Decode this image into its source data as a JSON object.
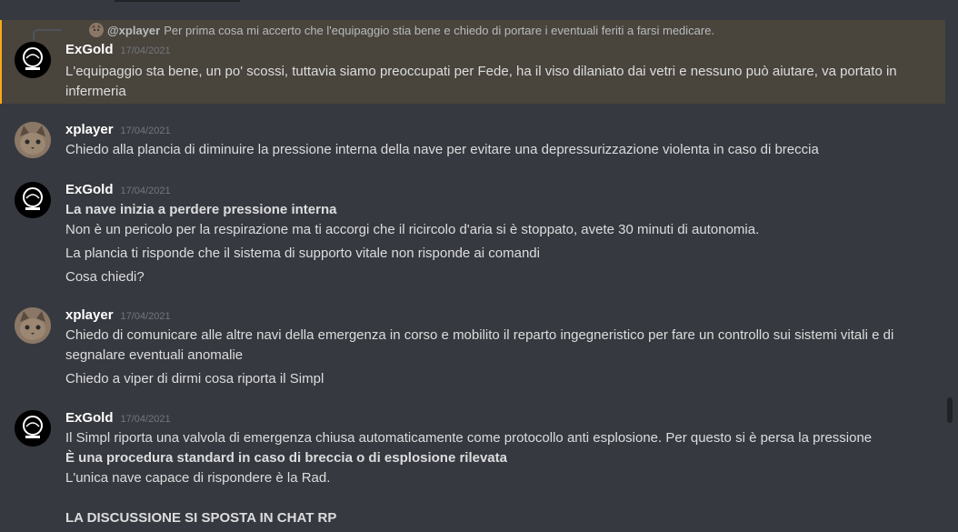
{
  "messages": [
    {
      "reply": {
        "author": "@xplayer",
        "text": "Per prima cosa mi accerto che l'equipaggio stia bene e chiedo di portare i eventuali feriti a farsi medicare."
      },
      "author": "ExGold",
      "timestamp": "17/04/2021",
      "lines": [
        "L'equipaggio sta bene, un po' scossi, tuttavia siamo preoccupati per Fede, ha il viso dilaniato dai vetri e nessuno può aiutare, va portato in",
        "infermeria"
      ]
    },
    {
      "author": "xplayer",
      "timestamp": "17/04/2021",
      "lines": [
        "Chiedo alla plancia di diminuire la pressione interna della nave per evitare una depressurizzazione violenta in caso di breccia"
      ]
    },
    {
      "author": "ExGold",
      "timestamp": "17/04/2021",
      "bold_line": "La nave inizia a perdere pressione interna",
      "lines": [
        "Non è un pericolo per la respirazione ma ti accorgi che il ricircolo d'aria si è stoppato, avete 30 minuti di autonomia.",
        "La plancia ti risponde che il sistema di supporto vitale non risponde ai comandi",
        "Cosa chiedi?"
      ]
    },
    {
      "author": "xplayer",
      "timestamp": "17/04/2021",
      "lines": [
        "Chiedo di comunicare alle altre navi della emergenza in corso e mobilito il reparto ingegneristico per fare un controllo sui sistemi vitali e di",
        "segnalare eventuali anomalie",
        "Chiedo a viper di dirmi cosa riporta il Simpl"
      ]
    },
    {
      "author": "ExGold",
      "timestamp": "17/04/2021",
      "lines": [
        "Il Simpl riporta una valvola di emergenza chiusa automaticamente come protocollo anti esplosione. Per questo si è persa la pressione",
        "È una procedura standard in caso di breccia o di esplosione rilevata",
        "L'unica nave capace di rispondere è la Rad.",
        "LA DISCUSSIONE SI SPOSTA IN CHAT RP"
      ]
    }
  ],
  "colors": {
    "background": "#36393f",
    "highlight_background": "#49443c",
    "highlight_border": "#faa81a",
    "author": "#ffffff",
    "text": "#dcddde",
    "timestamp": "#72767d"
  },
  "icons": {
    "exgold_avatar": "astronaut-helmet-avatar",
    "xplayer_avatar": "cat-avatar"
  }
}
